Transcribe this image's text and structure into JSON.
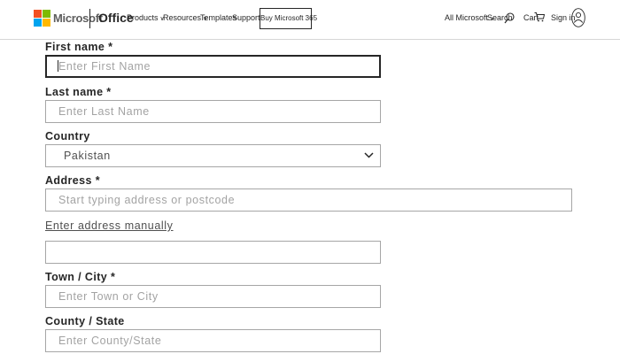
{
  "header": {
    "brand": "Microsoft",
    "product": "Office",
    "nav": {
      "products": "Products",
      "resources": "Resources",
      "templates": "Templates",
      "support": "Support"
    },
    "buy_button": "Buy Microsoft 365",
    "all_microsoft": "All Microsoft",
    "search": "Search",
    "cart": "Cart",
    "sign_in": "Sign in",
    "icons": [
      "microsoft-logo",
      "chevron-down-icon",
      "search-icon",
      "cart-icon",
      "avatar-icon"
    ],
    "logo_colors": [
      "#f25022",
      "#7fba00",
      "#00a4ef",
      "#ffb900"
    ]
  },
  "form": {
    "first_name": {
      "label": "First name *",
      "placeholder": "Enter First Name",
      "value": ""
    },
    "last_name": {
      "label": "Last name *",
      "placeholder": "Enter Last Name",
      "value": ""
    },
    "country": {
      "label": "Country",
      "value": "Pakistan"
    },
    "address": {
      "label": "Address *",
      "placeholder": "Start typing address or postcode",
      "value": ""
    },
    "manual_link": "Enter address manually",
    "manual_address": {
      "value": ""
    },
    "town": {
      "label": "Town / City *",
      "placeholder": "Enter Town or City",
      "value": ""
    },
    "county": {
      "label": "County / State",
      "placeholder": "Enter County/State",
      "value": ""
    }
  }
}
